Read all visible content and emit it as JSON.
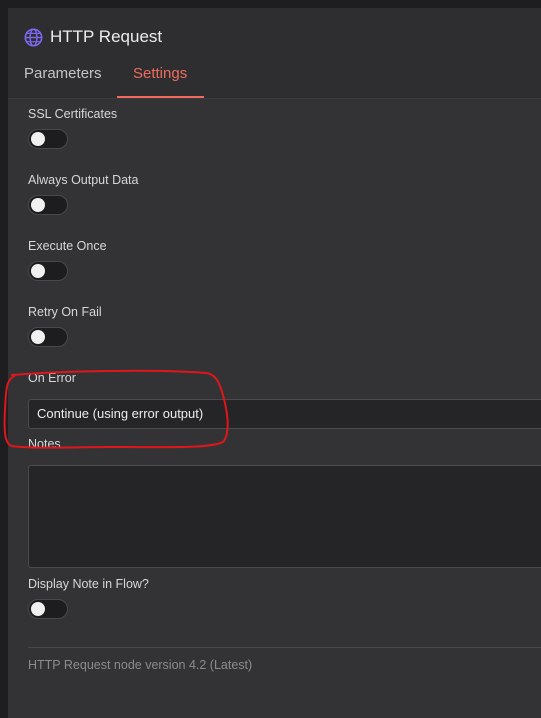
{
  "header": {
    "icon": "globe-icon",
    "icon_color": "#7b68ee",
    "title": "HTTP Request"
  },
  "tabs": [
    {
      "label": "Parameters",
      "active": false
    },
    {
      "label": "Settings",
      "active": true
    }
  ],
  "accent_color": "#ef6c5c",
  "settings": {
    "ssl_certificates": {
      "label": "SSL Certificates",
      "enabled": false
    },
    "always_output_data": {
      "label": "Always Output Data",
      "enabled": false
    },
    "execute_once": {
      "label": "Execute Once",
      "enabled": false
    },
    "retry_on_fail": {
      "label": "Retry On Fail",
      "enabled": false
    },
    "on_error": {
      "label": "On Error",
      "value": "Continue (using error output)"
    },
    "notes": {
      "label": "Notes",
      "value": ""
    },
    "display_note": {
      "label": "Display Note in Flow?",
      "enabled": false
    }
  },
  "footer": {
    "version_text": "HTTP Request node version 4.2 (Latest)"
  },
  "annotation": {
    "color": "#e0161b",
    "target": "On Error"
  }
}
